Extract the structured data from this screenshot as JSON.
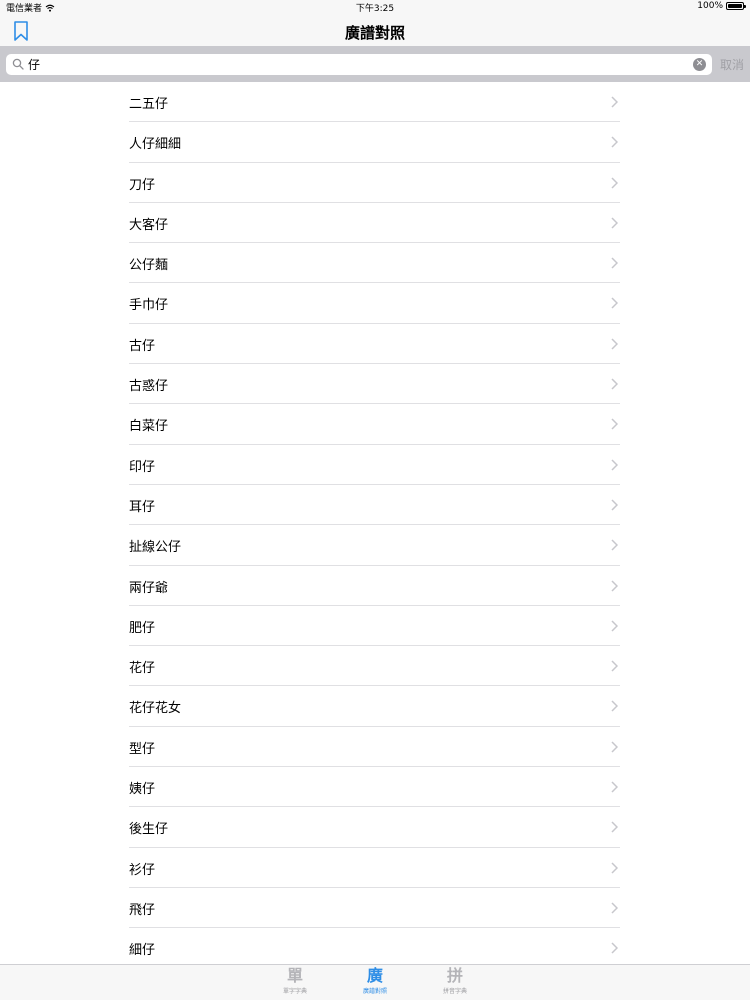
{
  "status_bar": {
    "carrier": "電信業者",
    "time": "下午3:25",
    "battery": "100%"
  },
  "nav": {
    "title": "廣譜對照",
    "bookmark_icon": "bookmark-icon"
  },
  "search": {
    "value": "仔",
    "cancel_label": "取消"
  },
  "results": [
    "二五仔",
    "人仔細細",
    "刀仔",
    "大客仔",
    "公仔麵",
    "手巾仔",
    "古仔",
    "古惑仔",
    "白菜仔",
    "印仔",
    "耳仔",
    "扯線公仔",
    "兩仔爺",
    "肥仔",
    "花仔",
    "花仔花女",
    "型仔",
    "姨仔",
    "後生仔",
    "衫仔",
    "飛仔",
    "細仔"
  ],
  "tabs": [
    {
      "glyph": "單",
      "label": "單字字典",
      "active": false
    },
    {
      "glyph": "廣",
      "label": "廣譜對照",
      "active": true
    },
    {
      "glyph": "拼",
      "label": "拼音字典",
      "active": false
    }
  ],
  "colors": {
    "accent": "#2f8ee6",
    "search_bg": "#c9c9ce"
  }
}
